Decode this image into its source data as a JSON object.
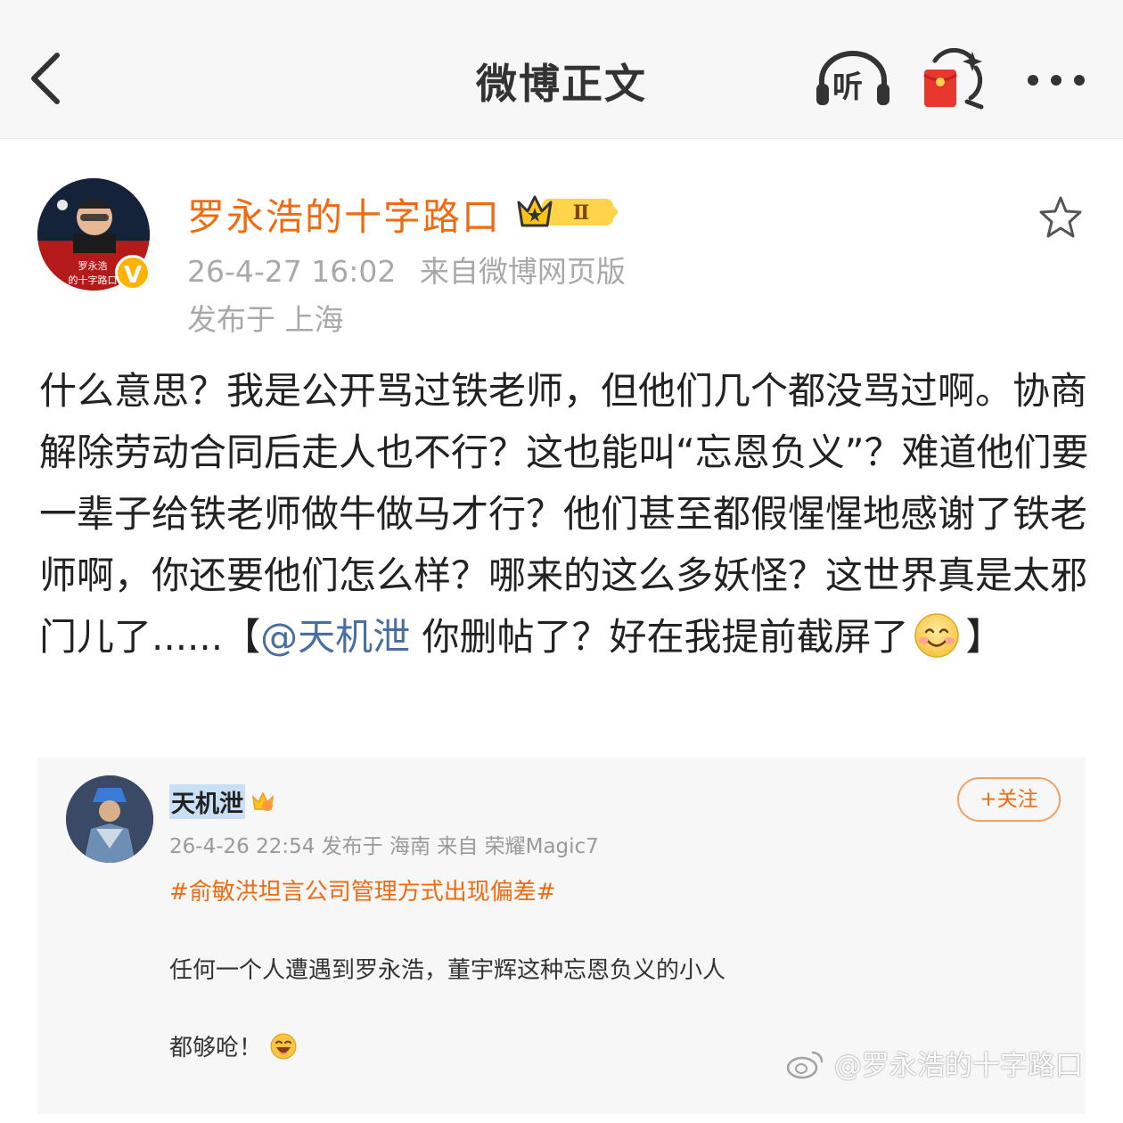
{
  "header": {
    "title": "微博正文",
    "listen_label": "听",
    "back_icon": "chevron-left-icon",
    "redpacket_icon": "red-envelope-icon",
    "more_icon": "more-dots-icon"
  },
  "post": {
    "author": "罗永浩的十字路口",
    "avatar_caption_line1": "罗永浩",
    "avatar_caption_line2": "的十字路口",
    "verified_badge": "V",
    "member_level": "Ⅱ",
    "time": "26-4-27 16:02",
    "source": "来自微博网页版",
    "location": "发布于 上海",
    "body_before_mention": "什么意思？我是公开骂过铁老师，但他们几个都没骂过啊。协商解除劳动合同后走人也不行？这也能叫“忘恩负义”？难道他们要一辈子给铁老师做牛做马才行？他们甚至都假惺惺地感谢了铁老师啊，你还要他们怎么样？哪来的这么多妖怪？这世界真是太邪门儿了......【",
    "mention": "@天机泄",
    "body_after_mention": " 你删帖了？好在我提前截屏了",
    "body_end": "】",
    "favorite_icon": "star-icon"
  },
  "quoted": {
    "name": "天机泄",
    "follow_label": "+关注",
    "meta": "26-4-26 22:54  发布于 海南  来自 荣耀Magic7",
    "topic": "#俞敏洪坦言公司管理方式出现偏差#",
    "line1": "任何一个人遭遇到罗永浩，董宇辉这种忘恩负义的小人",
    "line2": "都够呛！"
  },
  "watermark": "@罗永浩的十字路口",
  "colors": {
    "accent_orange": "#f06a0f",
    "mention_blue": "#496ea0",
    "meta_gray": "#a9a9a9",
    "badge_gold": "#ffb400",
    "redpacket_red": "#e8372c"
  }
}
